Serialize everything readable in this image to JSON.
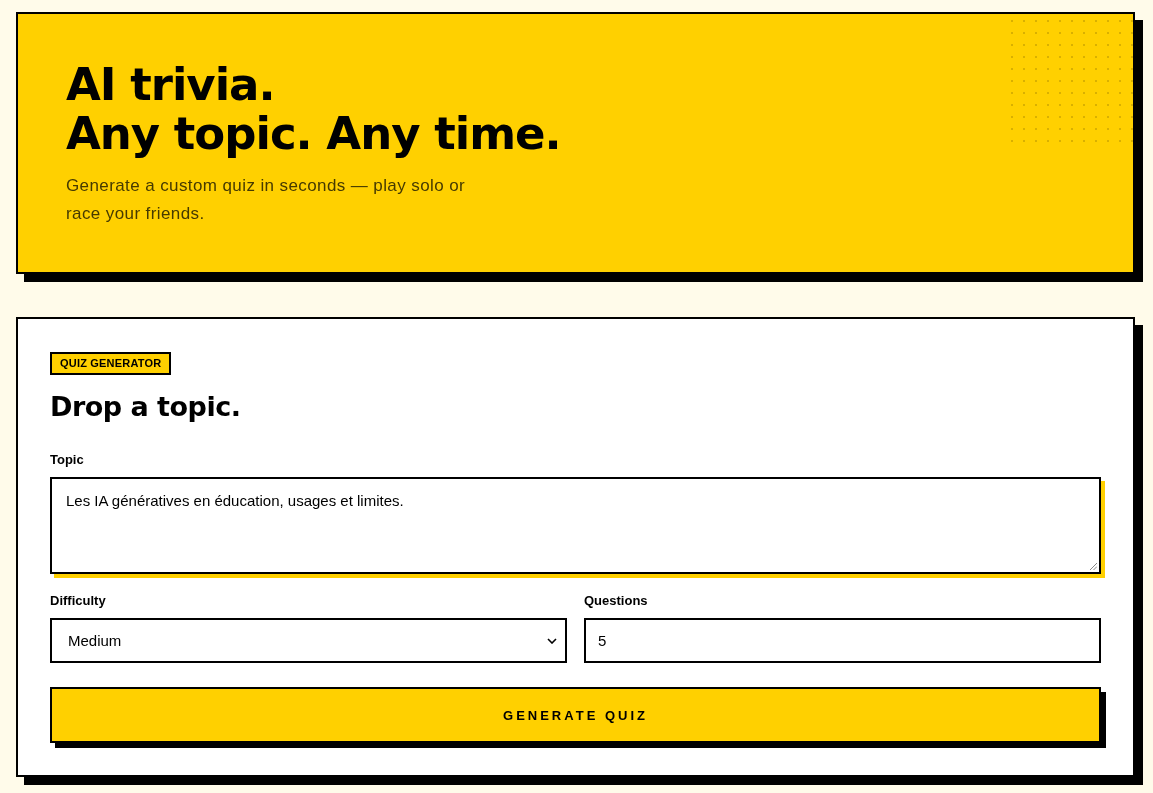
{
  "hero": {
    "title_lines": [
      "AI trivia.",
      "Any topic. Any time."
    ],
    "subtitle": "Generate a custom quiz in seconds — play solo or race your friends."
  },
  "form": {
    "badge": "QUIZ GENERATOR",
    "heading": "Drop a topic.",
    "topic": {
      "label": "Topic",
      "value": "Les IA génératives en éducation, usages et limites."
    },
    "difficulty": {
      "label": "Difficulty",
      "value": "Medium"
    },
    "questions": {
      "label": "Questions",
      "value": "5"
    },
    "submit": "GENERATE QUIZ"
  }
}
